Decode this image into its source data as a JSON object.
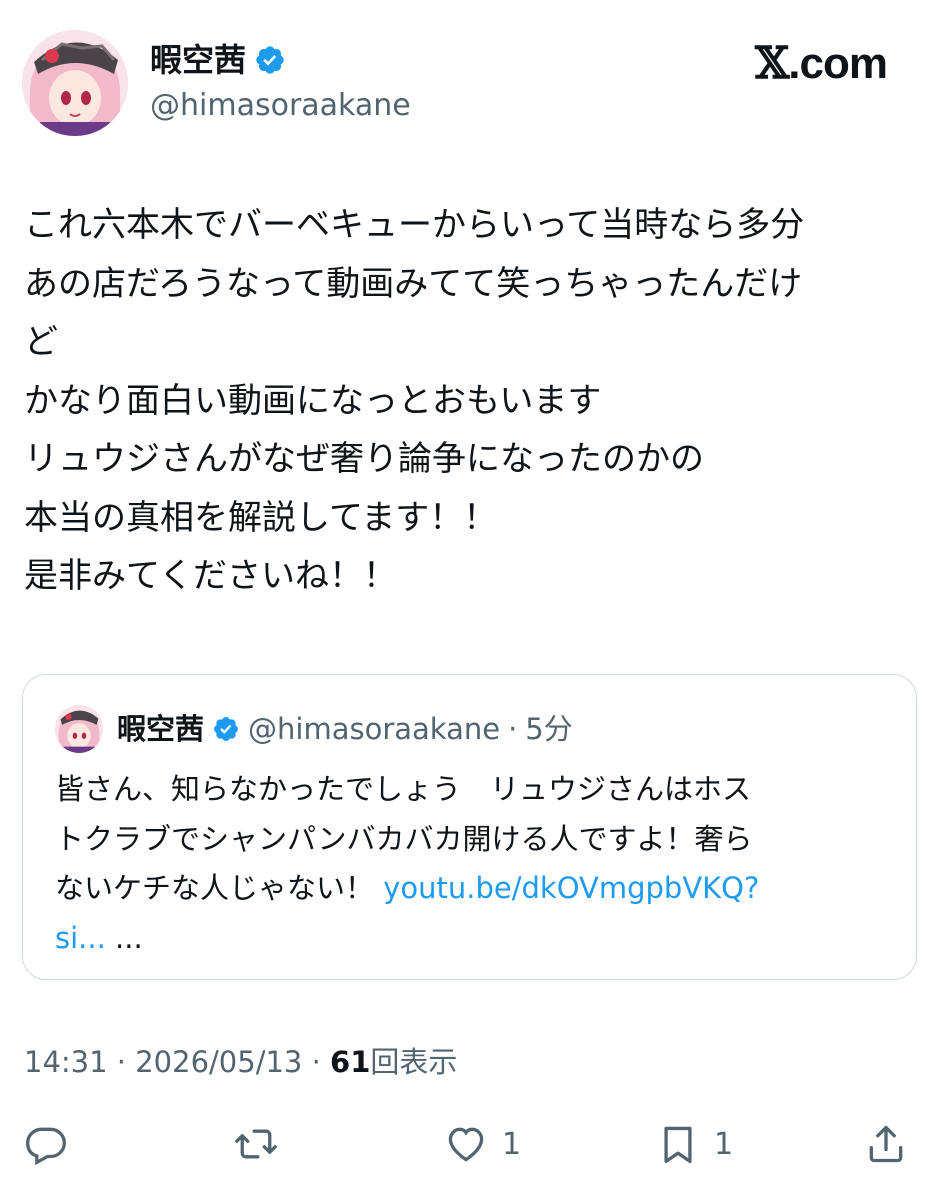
{
  "author": {
    "display_name": "暇空茜",
    "handle": "@himasoraakane",
    "verified": true
  },
  "brand": {
    "logo_x": "𝕏",
    "logo_suffix": ".com"
  },
  "tweet": {
    "lines": [
      "これ六本木でバーベキューからいって当時なら多分",
      "あの店だろうなって動画みてて笑っちゃったんだけ",
      "ど",
      "かなり面白い動画になっとおもいます",
      "リュウジさんがなぜ奢り論争になったのかの",
      "本当の真相を解説してます！！",
      "是非みてくださいね！！"
    ]
  },
  "quoted_tweet": {
    "display_name": "暇空茜",
    "handle": "@himasoraakane",
    "separator": "·",
    "time": "5分",
    "lines": [
      "皆さん、知らなかったでしょう　リュウジさんはホス",
      "トクラブでシャンパンバカバカ開ける人ですよ！奢ら",
      "ないケチな人じゃない！ "
    ],
    "link_part1": "youtu.be/dkOVmgpbVKQ?",
    "link_part2": "si...",
    "ellipsis": " ..."
  },
  "meta": {
    "time": "14:31",
    "sep1": " · ",
    "date": "2026/05/13",
    "sep2": " · ",
    "views_count": "61",
    "views_label": "回表示"
  },
  "actions": {
    "reply_count": "",
    "retweet_count": "",
    "like_count": "1",
    "bookmark_count": "1"
  },
  "colors": {
    "verified_blue": "#1d9bf0",
    "link": "#1d9bf0",
    "secondary_text": "#536471"
  },
  "icons": [
    "verified-icon",
    "reply-icon",
    "retweet-icon",
    "like-icon",
    "bookmark-icon",
    "share-icon"
  ]
}
